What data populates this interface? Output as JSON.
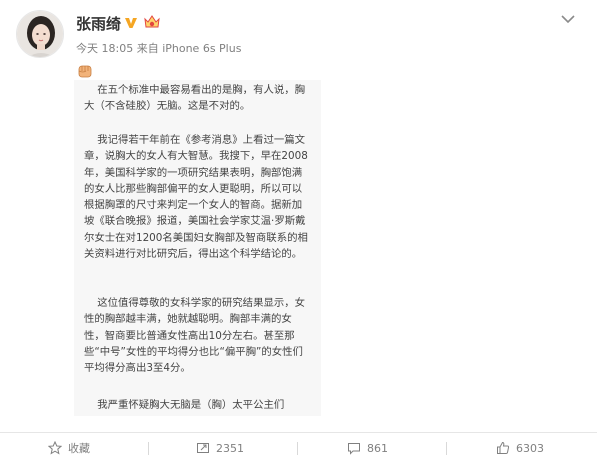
{
  "post": {
    "author_name": "张雨绮",
    "timestamp": "今天 18:05",
    "source": "来自 iPhone 6s Plus",
    "article_paragraphs": [
      "    在五个标准中最容易看出的是胸，有人说，胸大（不含硅胶）无脑。这是不对的。",
      "    我记得若干年前在《参考消息》上看过一篇文章，说胸大的女人有大智慧。我搜下，早在2008年，美国科学家的一项研究结果表明，胸部饱满的女人比那些胸部偏平的女人更聪明，所以可以根据胸罩的尺寸来判定一个女人的智商。据新加坡《联合晚报》报道，美国社会学家艾温·罗斯戴尔女士在对1200名美国妇女胸部及智商联系的相关资料进行对比研究后，得出这个科学结论的。",
      "    这位值得尊敬的女科学家的研究结果显示，女性的胸部越丰满，她就越聪明。胸部丰满的女性，智商要比普通女性高出10分左右。甚至那些“中号”女性的平均得分也比“偏平胸”的女性们平均得分高出3至4分。",
      "    我严重怀疑胸大无脑是（胸）太平公主们"
    ]
  },
  "actions": {
    "favorite_label": "收藏",
    "repost_count": "2351",
    "comment_count": "861",
    "like_count": "6303"
  },
  "icons": {
    "verified": "verified-v-icon",
    "member": "member-badge-icon",
    "menu": "chevron-down-icon",
    "fist": "fist-emoji-icon",
    "favorite": "star-icon",
    "repost": "repost-icon",
    "comment": "comment-icon",
    "like": "thumbs-up-icon"
  },
  "colors": {
    "verified_gold": "#f5a623",
    "member_red": "#e2463f",
    "meta_gray": "#808080"
  }
}
